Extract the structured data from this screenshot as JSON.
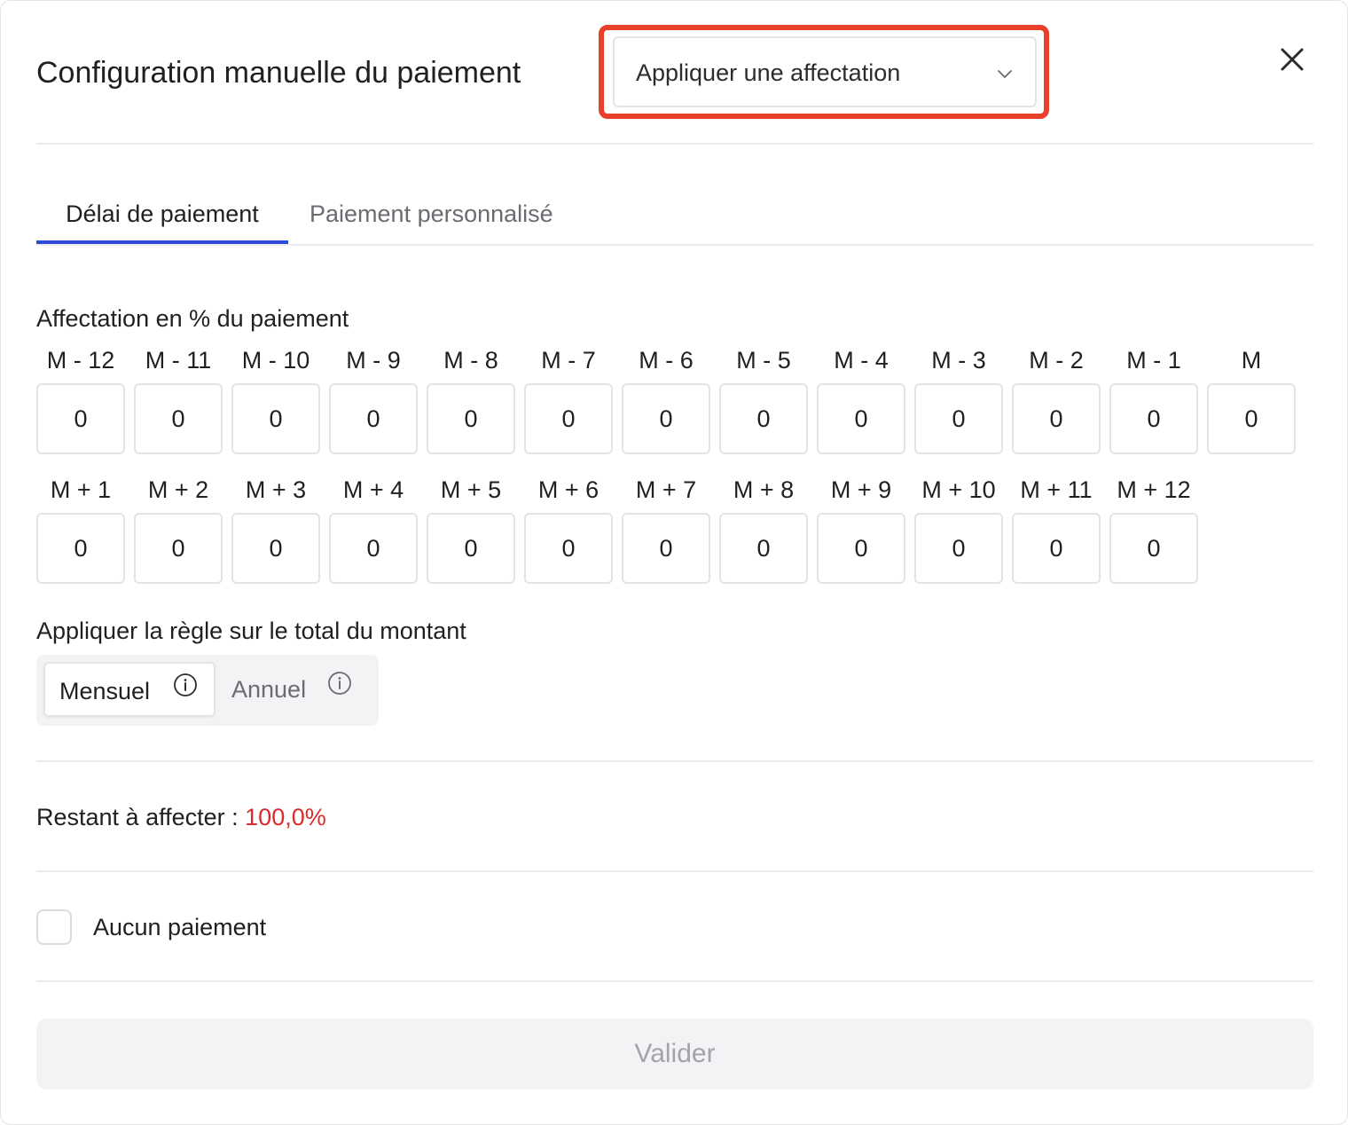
{
  "modal": {
    "title": "Configuration manuelle du paiement",
    "allocation_select": {
      "placeholder": "Appliquer une affectation"
    }
  },
  "tabs": [
    {
      "label": "Délai de paiement",
      "active": true
    },
    {
      "label": "Paiement personnalisé",
      "active": false
    }
  ],
  "allocation": {
    "label": "Affectation en % du paiement",
    "rows": [
      [
        {
          "label": "M - 12",
          "value": "0"
        },
        {
          "label": "M - 11",
          "value": "0"
        },
        {
          "label": "M - 10",
          "value": "0"
        },
        {
          "label": "M - 9",
          "value": "0"
        },
        {
          "label": "M - 8",
          "value": "0"
        },
        {
          "label": "M - 7",
          "value": "0"
        },
        {
          "label": "M - 6",
          "value": "0"
        },
        {
          "label": "M - 5",
          "value": "0"
        },
        {
          "label": "M - 4",
          "value": "0"
        },
        {
          "label": "M - 3",
          "value": "0"
        },
        {
          "label": "M - 2",
          "value": "0"
        },
        {
          "label": "M - 1",
          "value": "0"
        },
        {
          "label": "M",
          "value": "0"
        }
      ],
      [
        {
          "label": "M + 1",
          "value": "0"
        },
        {
          "label": "M + 2",
          "value": "0"
        },
        {
          "label": "M + 3",
          "value": "0"
        },
        {
          "label": "M + 4",
          "value": "0"
        },
        {
          "label": "M + 5",
          "value": "0"
        },
        {
          "label": "M + 6",
          "value": "0"
        },
        {
          "label": "M + 7",
          "value": "0"
        },
        {
          "label": "M + 8",
          "value": "0"
        },
        {
          "label": "M + 9",
          "value": "0"
        },
        {
          "label": "M + 10",
          "value": "0"
        },
        {
          "label": "M + 11",
          "value": "0"
        },
        {
          "label": "M + 12",
          "value": "0"
        }
      ]
    ]
  },
  "rule": {
    "label": "Appliquer la règle sur le total du montant",
    "options": [
      {
        "label": "Mensuel",
        "selected": true
      },
      {
        "label": "Annuel",
        "selected": false
      }
    ]
  },
  "remaining": {
    "label": "Restant à affecter :",
    "value": "100,0%"
  },
  "no_payment": {
    "label": "Aucun paiement",
    "checked": false
  },
  "submit": {
    "label": "Valider"
  },
  "colors": {
    "accent": "#2f4bd6",
    "highlight": "#e8402a",
    "remaining_value": "#d92b2b"
  },
  "icons": {
    "close": "close-icon",
    "dropdown": "chevron-down-icon",
    "info": "info-icon"
  }
}
